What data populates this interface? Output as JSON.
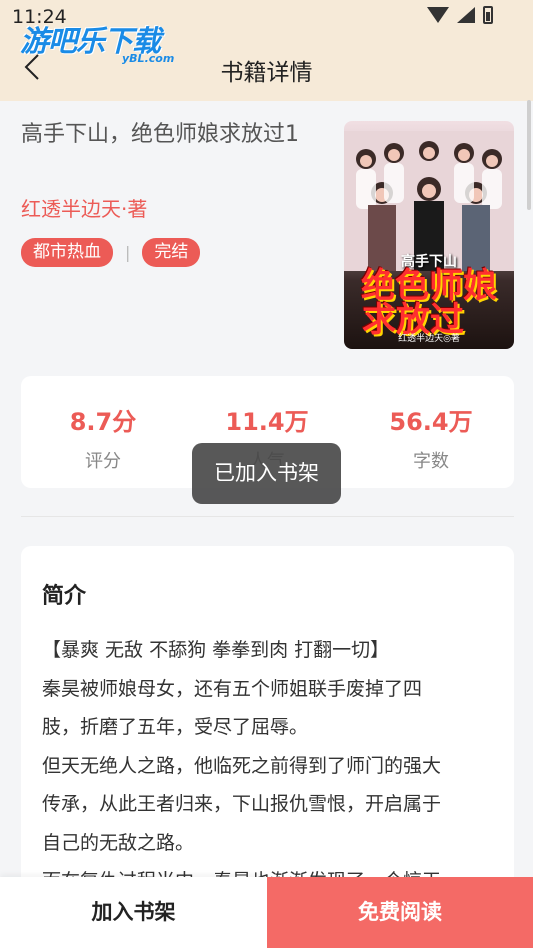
{
  "status": {
    "time": "11:24"
  },
  "logo": {
    "text": "游吧乐下载",
    "sub": "yBL.com"
  },
  "header": {
    "title": "书籍详情"
  },
  "book": {
    "title": "高手下山，绝色师娘求放过1",
    "author": "红透半边天·著",
    "tags": [
      "都市热血",
      "完结"
    ],
    "separator": "|",
    "cover": {
      "line1": "高手下山",
      "line2": "绝色师娘",
      "line3": "求放过",
      "author": "红透半边天◎著"
    }
  },
  "stats": [
    {
      "value": "8.7分",
      "label": "评分"
    },
    {
      "value": "11.4万",
      "label": "人气"
    },
    {
      "value": "56.4万",
      "label": "字数"
    }
  ],
  "intro": {
    "heading": "简介",
    "lines": [
      "【暴爽 无敌 不舔狗 拳拳到肉 打翻一切】",
      "秦昊被师娘母女，还有五个师姐联手废掉了四",
      "肢，折磨了五年，受尽了屈辱。",
      "但天无绝人之路，他临死之前得到了师门的强大",
      "传承，从此王者归来，下山报仇雪恨，开启属于",
      "自己的无敌之路。",
      "而在复仇过程当中，秦昊也渐渐发现了一个惊天"
    ]
  },
  "toast": {
    "text": "已加入书架"
  },
  "bottom": {
    "add_label": "加入书架",
    "read_label": "免费阅读"
  },
  "colors": {
    "accent": "#ec5b56",
    "header_bg": "#f6ead8",
    "read_button": "#f46a66"
  }
}
